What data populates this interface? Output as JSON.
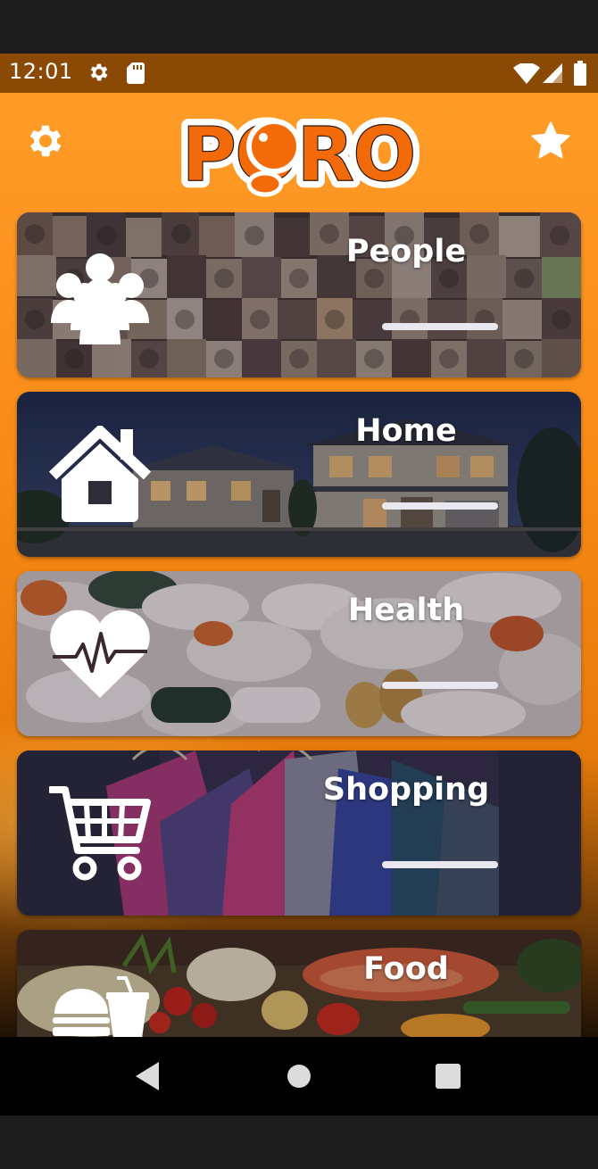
{
  "status_bar": {
    "time": "12:01",
    "icons": [
      "settings-gear-icon",
      "sd-card-icon",
      "wifi-icon",
      "cell-signal-icon",
      "battery-icon"
    ]
  },
  "header": {
    "logo_text": "PORO",
    "settings_icon": "gear-icon",
    "favorites_icon": "star-icon"
  },
  "categories": [
    {
      "label": "People",
      "icon": "people-group-icon"
    },
    {
      "label": "Home",
      "icon": "house-icon"
    },
    {
      "label": "Health",
      "icon": "heart-pulse-icon"
    },
    {
      "label": "Shopping",
      "icon": "shopping-cart-icon"
    },
    {
      "label": "Food",
      "icon": "burger-drink-icon"
    }
  ],
  "nav_bar": {
    "icons": [
      "back-icon",
      "home-circle-icon",
      "recents-square-icon"
    ]
  },
  "colors": {
    "status_bar": "#8a4a05",
    "app_orange": "#ff9c28",
    "logo_orange": "#f26a0a",
    "card_text": "#ffffff"
  }
}
